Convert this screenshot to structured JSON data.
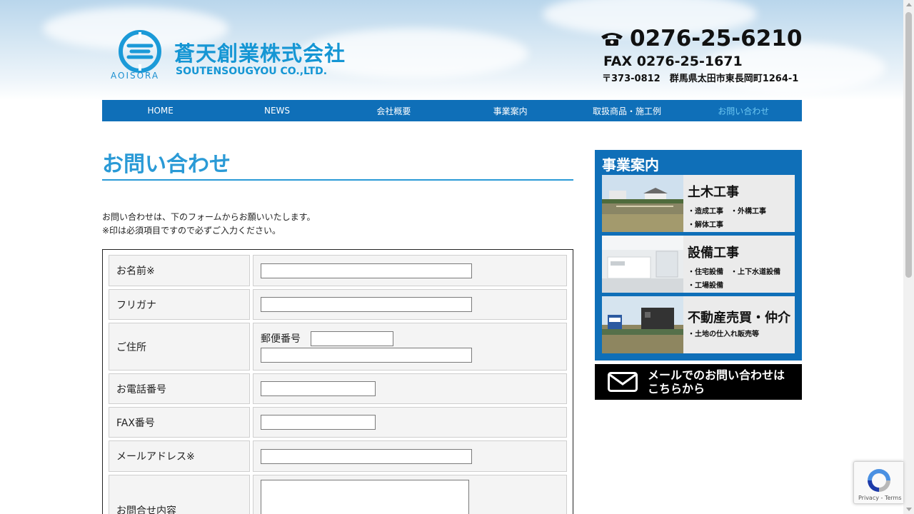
{
  "header": {
    "company_jp": "蒼天創業株式会社",
    "company_en": "SOUTENSOUGYOU CO.,LTD.",
    "logo_sub": "AOISORA",
    "tel": "0276-25-6210",
    "fax": "FAX 0276-25-1671",
    "address": "〒373-0812　群馬県太田市東長岡町1264-1"
  },
  "nav": {
    "items": [
      {
        "label": "HOME"
      },
      {
        "label": "NEWS"
      },
      {
        "label": "会社概要"
      },
      {
        "label": "事業案内"
      },
      {
        "label": "取扱商品・施工例"
      },
      {
        "label": "お問い合わせ"
      }
    ],
    "active_index": 5
  },
  "main": {
    "title": "お問い合わせ",
    "intro_line1": "お問い合わせは、下のフォームからお願いいたします。",
    "intro_line2": "※印は必須項目ですので必ずご入力ください。"
  },
  "form": {
    "name_label": "お名前※",
    "name_value": "",
    "furigana_label": "フリガナ",
    "furigana_value": "",
    "address_label": "ご住所",
    "postal_label": "郵便番号",
    "postal_value": "",
    "address_value": "",
    "phone_label": "お電話番号",
    "phone_value": "",
    "fax_label": "FAX番号",
    "fax_value": "",
    "email_label": "メールアドレス※",
    "email_value": "",
    "message_label": "お問合せ内容",
    "message_value": ""
  },
  "sidebar": {
    "title": "事業案内",
    "items": [
      {
        "title": "土木工事",
        "sub1": "・造成工事　・外構工事",
        "sub2": "・解体工事"
      },
      {
        "title": "設備工事",
        "sub1": "・住宅設備　・上下水道設備",
        "sub2": "・工場設備"
      },
      {
        "title": "不動産売買・仲介",
        "sub1": "・土地の仕入れ販売等",
        "sub2": ""
      }
    ],
    "mail_line1": "メールでのお問い合わせは",
    "mail_line2": "こちらから"
  },
  "recaptcha": {
    "links": "Privacy - Terms"
  },
  "colors": {
    "brand_blue": "#0f6fb8",
    "title_blue": "#2a9ad6",
    "nav_active": "#6dc7f2"
  }
}
